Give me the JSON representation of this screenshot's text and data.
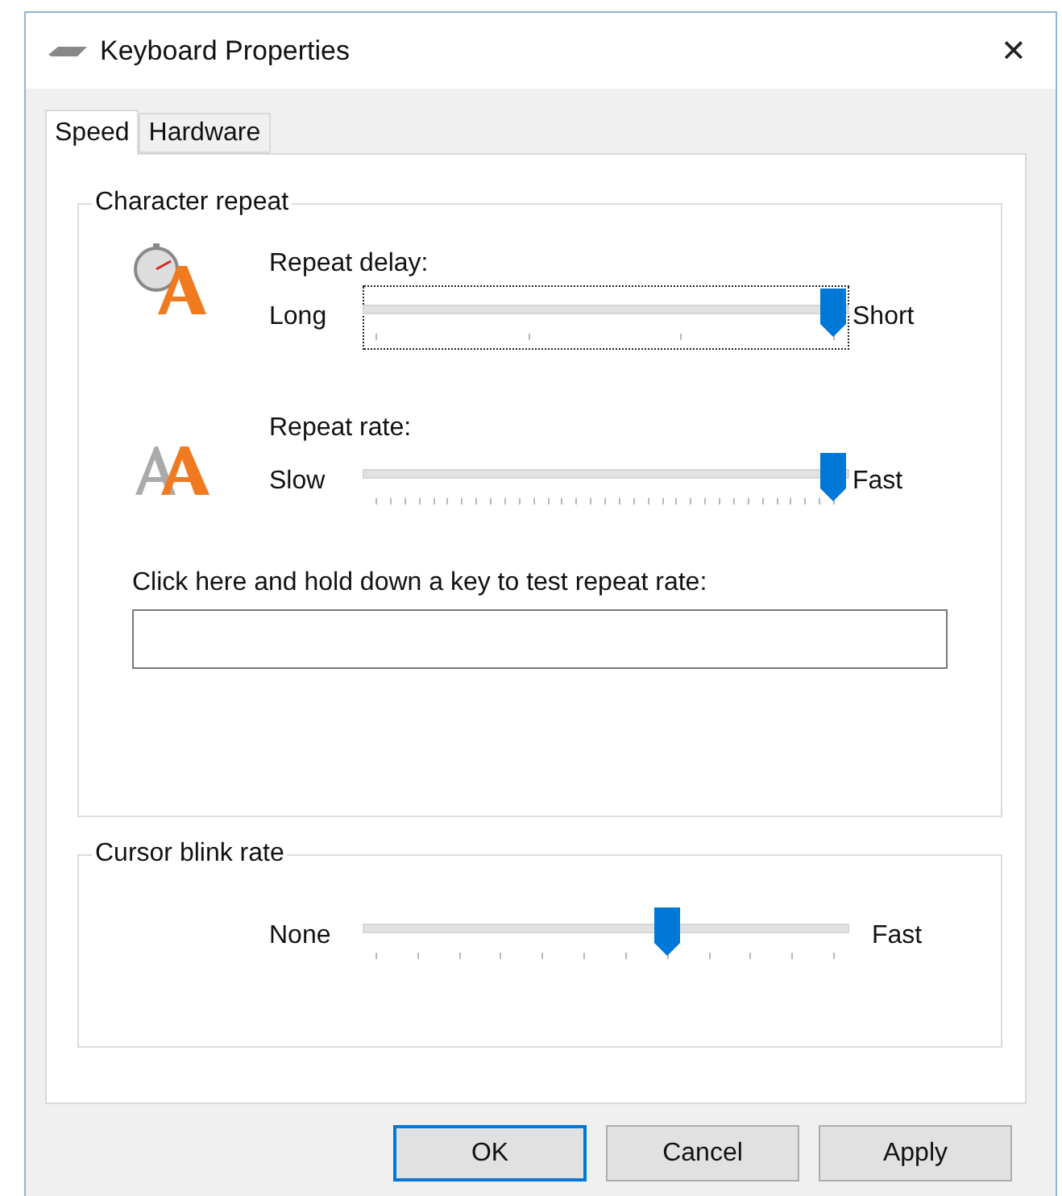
{
  "window": {
    "title": "Keyboard Properties",
    "close": "✕"
  },
  "tabs": [
    {
      "label": "Speed",
      "selected": true
    },
    {
      "label": "Hardware",
      "selected": false
    }
  ],
  "character_repeat": {
    "title": "Character repeat",
    "sliders": [
      {
        "label": "Repeat delay:",
        "min_label": "Long",
        "max_label": "Short",
        "level": 1,
        "focused": true
      },
      {
        "label": "Repeat rate:",
        "min_label": "Slow",
        "max_label": "Fast",
        "level": 1,
        "focused": false
      }
    ],
    "test_label": "Click here and hold down a key to test repeat rate:"
  },
  "cursor_blink": {
    "title": "Cursor blink rate",
    "min_label": "None",
    "max_label": "Fast",
    "level": 0.636
  },
  "buttons": [
    {
      "label": "OK",
      "default": true
    },
    {
      "label": "Cancel",
      "default": false
    },
    {
      "label": "Apply",
      "default": false
    }
  ]
}
